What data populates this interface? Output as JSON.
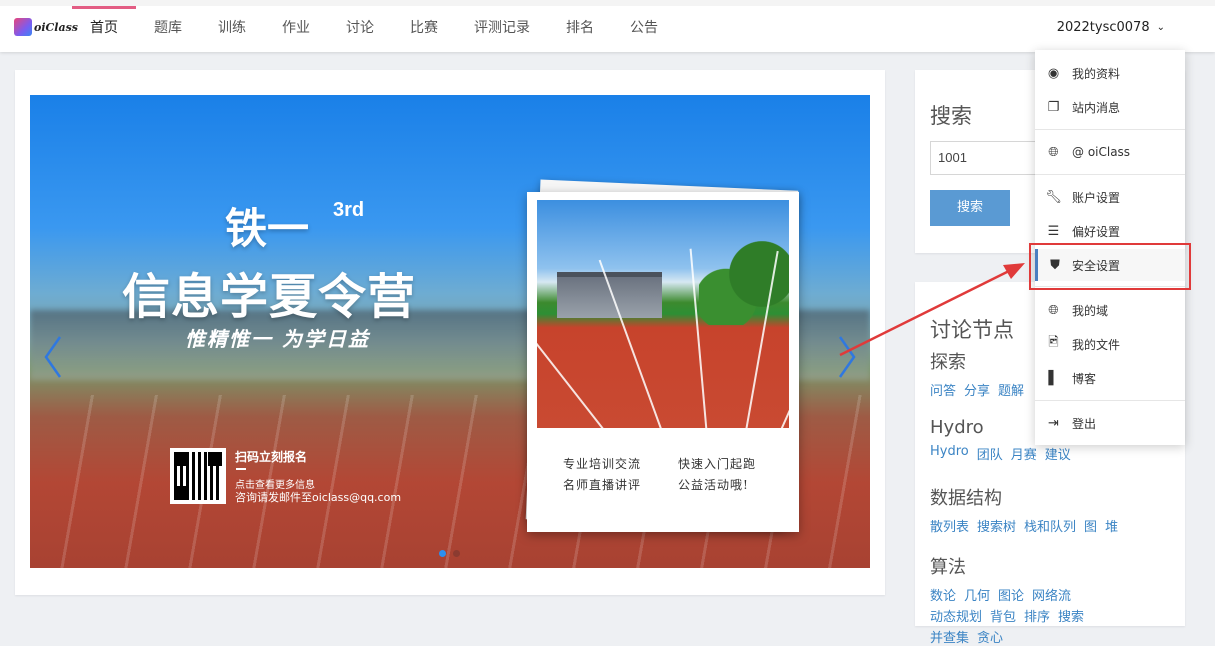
{
  "app": {
    "logo_text": "oiClass"
  },
  "nav": {
    "items": [
      {
        "label": "首页",
        "active": true
      },
      {
        "label": "题库"
      },
      {
        "label": "训练"
      },
      {
        "label": "作业"
      },
      {
        "label": "讨论"
      },
      {
        "label": "比赛"
      },
      {
        "label": "评测记录"
      },
      {
        "label": "排名"
      },
      {
        "label": "公告"
      }
    ],
    "user": "2022tysc0078"
  },
  "banner": {
    "title1": "铁一",
    "sup": "3rd",
    "title2": "信息学夏令营",
    "subtitle": "惟精惟一 为学日益",
    "qr_title": "扫码立刻报名",
    "qr_line1": "点击查看更多信息",
    "qr_line2": "咨询请发邮件至oiclass@qq.com",
    "photo_left": [
      "专业培训交流",
      "名师直播讲评"
    ],
    "photo_right": [
      "快速入门起跑",
      "公益活动哦!"
    ]
  },
  "search": {
    "title": "搜索",
    "value": "1001",
    "button": "搜索"
  },
  "nodes": {
    "title": "讨论节点",
    "groups": [
      {
        "name": "探索",
        "links": [
          "问答",
          "分享",
          "题解"
        ]
      },
      {
        "name": "Hydro",
        "links": [
          "Hydro",
          "团队",
          "月赛",
          "建议"
        ]
      },
      {
        "name": "数据结构",
        "links": [
          "散列表",
          "搜索树",
          "栈和队列",
          "图",
          "堆"
        ]
      },
      {
        "name": "算法",
        "links": [
          "数论",
          "几何",
          "图论",
          "网络流",
          "动态规划",
          "背包",
          "排序",
          "搜索",
          "并查集",
          "贪心"
        ]
      }
    ]
  },
  "menu": {
    "items": [
      {
        "label": "我的资料",
        "icon": "user-circle-icon"
      },
      {
        "label": "站内消息",
        "icon": "messages-icon"
      },
      {
        "label": "@ oiClass",
        "icon": "globe-icon"
      },
      {
        "label": "账户设置",
        "icon": "wrench-icon"
      },
      {
        "label": "偏好设置",
        "icon": "sliders-icon"
      },
      {
        "label": "安全设置",
        "icon": "shield-icon",
        "selected": true
      },
      {
        "label": "我的域",
        "icon": "globe-icon"
      },
      {
        "label": "我的文件",
        "icon": "file-image-icon"
      },
      {
        "label": "博客",
        "icon": "book-icon"
      },
      {
        "label": "登出",
        "icon": "logout-icon"
      }
    ]
  },
  "colors": {
    "accent": "#e35d84",
    "link": "#3b84c4",
    "button": "#5a9ad3",
    "highlight": "#e03a3a"
  }
}
